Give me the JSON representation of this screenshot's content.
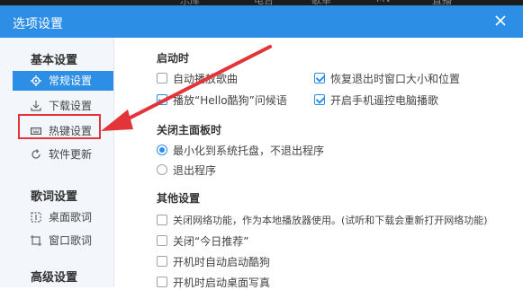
{
  "background_tabs": [
    "乐库",
    "电台",
    "歌单",
    "MV",
    "直播"
  ],
  "dialog": {
    "title": "选项设置",
    "close_icon": "close-icon"
  },
  "sidebar": {
    "sections": [
      {
        "title": "基本设置",
        "items": [
          {
            "label": "常规设置",
            "icon": "gear-icon",
            "active": true
          },
          {
            "label": "下载设置",
            "icon": "download-icon",
            "active": false
          },
          {
            "label": "热键设置",
            "icon": "keyboard-icon",
            "active": false
          },
          {
            "label": "软件更新",
            "icon": "refresh-icon",
            "active": false
          }
        ]
      },
      {
        "title": "歌词设置",
        "items": [
          {
            "label": "桌面歌词",
            "icon": "desktop-lyrics-icon",
            "active": false
          },
          {
            "label": "窗口歌词",
            "icon": "window-lyrics-icon",
            "active": false
          }
        ]
      },
      {
        "title": "高级设置",
        "items": []
      }
    ]
  },
  "content": {
    "startup": {
      "title": "启动时",
      "options": [
        {
          "label": "自动播放歌曲",
          "checked": false
        },
        {
          "label": "恢复退出时窗口大小和位置",
          "checked": true
        },
        {
          "label": "播放“Hello酷狗”问候语",
          "checked": true
        },
        {
          "label": "开启手机遥控电脑播歌",
          "checked": true
        }
      ]
    },
    "close_panel": {
      "title": "关闭主面板时",
      "options": [
        {
          "label": "最小化到系统托盘，不退出程序",
          "checked": true
        },
        {
          "label": "退出程序",
          "checked": false
        }
      ]
    },
    "other": {
      "title": "其他设置",
      "options": [
        {
          "label": "关闭网络功能，作为本地播放器使用。(试听和下载会重新打开网络功能)",
          "checked": false
        },
        {
          "label": "关闭“今日推荐”",
          "checked": false
        },
        {
          "label": "开机时自动启动酷狗",
          "checked": false
        },
        {
          "label": "开机时启动桌面写真",
          "checked": false
        }
      ]
    }
  },
  "colors": {
    "accent": "#2d8ee5",
    "annotation": "#e3343a"
  }
}
